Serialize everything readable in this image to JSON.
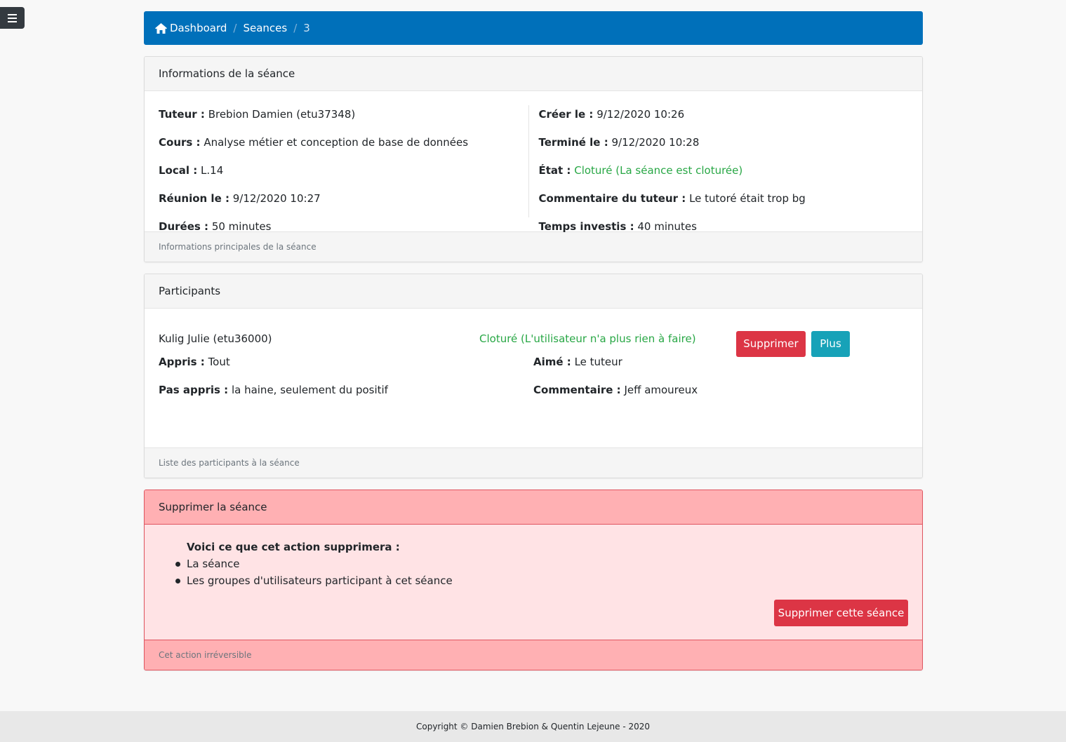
{
  "breadcrumb": {
    "home_label": "Dashboard",
    "separator": "/",
    "seances_label": "Seances",
    "current": "3"
  },
  "info_card": {
    "header": "Informations de la séance",
    "footer": "Informations principales de la séance",
    "left": [
      {
        "label": "Tuteur :",
        "value": "Brebion Damien (etu37348)"
      },
      {
        "label": "Cours :",
        "value": "Analyse métier et conception de base de données"
      },
      {
        "label": "Local :",
        "value": "L.14"
      },
      {
        "label": "Réunion le :",
        "value": "9/12/2020 10:27"
      },
      {
        "label": "Durées :",
        "value": "50 minutes"
      }
    ],
    "right": [
      {
        "label": "Créer le :",
        "value": "9/12/2020 10:26"
      },
      {
        "label": "Terminé le :",
        "value": "9/12/2020 10:28"
      },
      {
        "label": "État :",
        "value": "Cloturé (La séance est cloturée)"
      },
      {
        "label": "Commentaire du tuteur :",
        "value": "Le tutoré était trop bg"
      },
      {
        "label": "Temps investis :",
        "value": "40 minutes"
      }
    ]
  },
  "participants_card": {
    "header": "Participants",
    "footer": "Liste des participants à la séance",
    "participant": {
      "name": "Kulig Julie (etu36000)",
      "status": "Cloturé (L'utilisateur n'a plus rien à faire)",
      "delete_label": "Supprimer",
      "more_label": "Plus",
      "learned_label": "Appris :",
      "learned_value": "Tout",
      "not_learned_label": "Pas appris :",
      "not_learned_value": "la haine, seulement du positif",
      "liked_label": "Aimé :",
      "liked_value": "Le tuteur",
      "comment_label": "Commentaire :",
      "comment_value": "Jeff amoureux"
    }
  },
  "delete_card": {
    "header": "Supprimer la séance",
    "intro": "Voici ce que cet action supprimera :",
    "items": [
      "La séance",
      "Les groupes d'utilisateurs participant à cet séance"
    ],
    "button_label": "Supprimer cette séance",
    "footer": "Cet action irréversible"
  },
  "footer": {
    "copyright": "Copyright © Damien Brebion & Quentin Lejeune - 2020"
  },
  "colors": {
    "primary": "#0070ba",
    "success": "#28a745",
    "danger": "#dc3545",
    "info": "#17a2b8"
  },
  "icons": {
    "menu": "hamburger-icon",
    "home": "home-icon"
  }
}
